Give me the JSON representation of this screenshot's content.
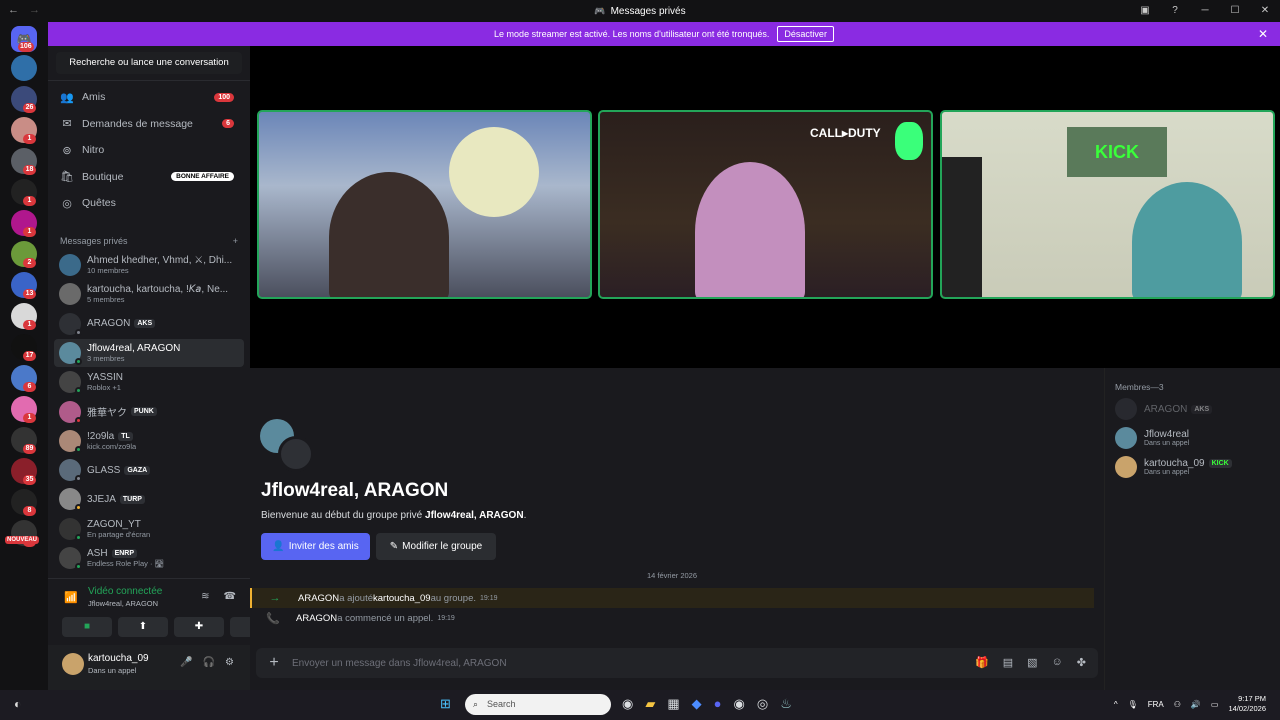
{
  "window": {
    "title": "Messages privés"
  },
  "banner": {
    "text": "Le mode streamer est activé. Les noms d'utilisateur ont été tronqués.",
    "button": "Désactiver"
  },
  "servers": {
    "home_badge": "106",
    "items": [
      {
        "badge": ""
      },
      {
        "badge": "26"
      },
      {
        "badge": "1"
      },
      {
        "badge": "18"
      },
      {
        "badge": "1"
      },
      {
        "badge": "1"
      },
      {
        "badge": "2"
      },
      {
        "badge": "13"
      },
      {
        "badge": "1"
      },
      {
        "badge": "17"
      },
      {
        "badge": "6"
      },
      {
        "badge": "1"
      },
      {
        "badge": "89"
      },
      {
        "badge": "35"
      },
      {
        "badge": "8"
      },
      {
        "badge": "1"
      }
    ],
    "nouveau": "NOUVEAU"
  },
  "sidebar": {
    "search": "Recherche ou lance une conversation",
    "nav": [
      {
        "label": "Amis",
        "badge": "100",
        "icon": "friends-icon"
      },
      {
        "label": "Demandes de message",
        "badge": "6",
        "icon": "mail-icon"
      },
      {
        "label": "Nitro",
        "badge": "",
        "icon": "nitro-icon"
      },
      {
        "label": "Boutique",
        "deal": "BONNE AFFAIRE",
        "icon": "shop-icon"
      },
      {
        "label": "Quêtes",
        "badge": "",
        "icon": "quests-icon"
      }
    ],
    "dm_header": "Messages privés",
    "dms": [
      {
        "name": "Ahmed khedher, Vhmd, ⚔, Dhi...",
        "sub": "10 membres"
      },
      {
        "name": "kartoucha, kartoucha, !𝘒𝘢, Ne...",
        "sub": "5 membres"
      },
      {
        "name": "ARAGON",
        "tag": "AKS",
        "sub": ""
      },
      {
        "name": "Jflow4real, ARAGON",
        "sub": "3 membres"
      },
      {
        "name": "YASSIN",
        "sub": "Roblox +1"
      },
      {
        "name": "雅華ヤク",
        "tag": "PUNK",
        "sub": ""
      },
      {
        "name": "!2o9la",
        "tag": "TL",
        "sub": "kick.com/zo9la"
      },
      {
        "name": "GLASS",
        "tag": "GAZA",
        "sub": ""
      },
      {
        "name": "3JEJA",
        "tag": "TURP",
        "sub": ""
      },
      {
        "name": "ZAGON_YT",
        "sub": "En partage d'écran"
      },
      {
        "name": "ASH",
        "tag": "ENRP",
        "sub": "Endless Role Play · 🛣"
      }
    ]
  },
  "voice": {
    "status": "Vidéo connectée",
    "channel": "Jflow4real, ARAGON"
  },
  "user": {
    "name": "kartoucha_09",
    "status": "Dans un appel"
  },
  "group": {
    "title": "Jflow4real, ARAGON",
    "welcome_prefix": "Bienvenue au début du groupe privé ",
    "welcome_name": "Jflow4real, ARAGON",
    "welcome_suffix": ".",
    "invite": "Inviter des amis",
    "edit": "Modifier le groupe"
  },
  "messages": {
    "date": "14 février 2026",
    "items": [
      {
        "actor": "ARAGON",
        "action": " a ajouté ",
        "target": "kartoucha_09",
        "rest": " au groupe.",
        "time": "19:19"
      },
      {
        "actor": "ARAGON",
        "action": " a commencé un appel.",
        "target": "",
        "rest": "",
        "time": "19:19"
      }
    ],
    "placeholder": "Envoyer un message dans Jflow4real, ARAGON"
  },
  "members": {
    "header": "Membres—3",
    "list": [
      {
        "name": "ARAGON",
        "tag": "AKS",
        "status": ""
      },
      {
        "name": "Jflow4real",
        "tag": "",
        "status": "Dans un appel"
      },
      {
        "name": "kartoucha_09",
        "tag": "KICK",
        "status": "Dans un appel"
      }
    ]
  },
  "stream_tiles": {
    "tile2_overlay": "CALL▸DUTY",
    "tile3_overlay": "KICK"
  },
  "taskbar": {
    "search": "Search",
    "lang": "FRA",
    "time": "9:17 PM",
    "date": "14/02/2026"
  }
}
